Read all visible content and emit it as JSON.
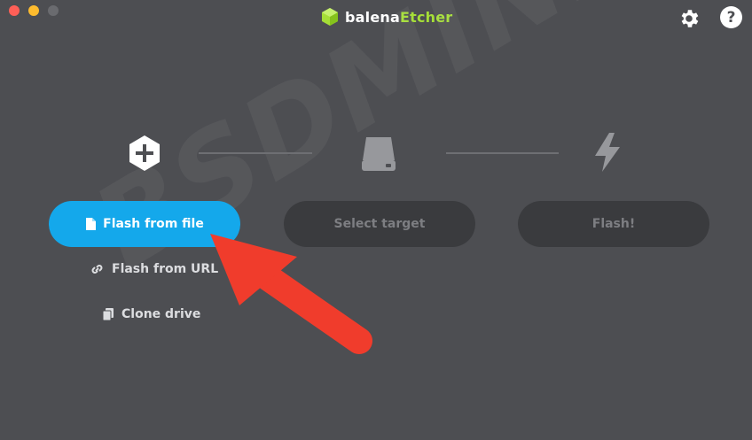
{
  "app": {
    "brand_primary": "balena",
    "brand_secondary": "Etcher",
    "brand_accent_color": "#a5de37"
  },
  "toolbar": {
    "settings_icon": "gear-icon",
    "help_label": "?"
  },
  "steps": [
    {
      "icon": "plus-hexagon-icon",
      "label": "Flash from file",
      "state": "active",
      "color": "#14a8eb"
    },
    {
      "icon": "drive-icon",
      "label": "Select target",
      "state": "disabled"
    },
    {
      "icon": "lightning-icon",
      "label": "Flash!",
      "state": "disabled"
    }
  ],
  "source_options": [
    {
      "icon": "link-icon",
      "label": "Flash from URL"
    },
    {
      "icon": "copy-icon",
      "label": "Clone drive"
    }
  ],
  "overlay": {
    "watermark_text": "BSDMINERS",
    "annotation": "red-arrow"
  }
}
